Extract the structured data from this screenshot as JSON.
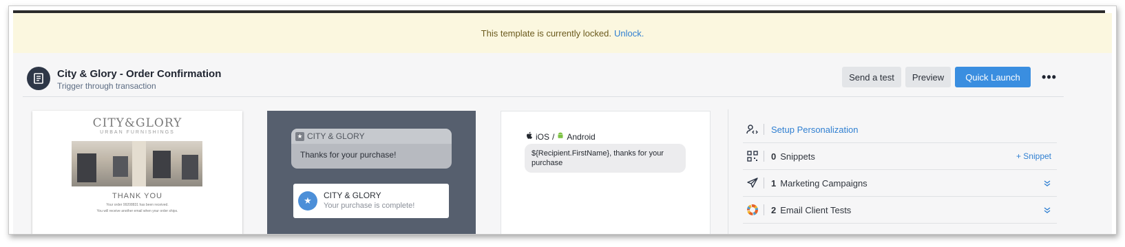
{
  "banner": {
    "text": "This template is currently locked.",
    "link": "Unlock."
  },
  "header": {
    "title": "City & Glory - Order Confirmation",
    "subtitle": "Trigger through transaction",
    "send_test": "Send a test",
    "preview": "Preview",
    "quick_launch": "Quick Launch",
    "more": "•••"
  },
  "email_preview": {
    "logo": "CITY&GLORY",
    "logo_sub": "URBAN FURNISHINGS",
    "thank_you": "THANK YOU",
    "line1": "Your order 99208831 has been received.",
    "line2": "You will receive another email when your order ships."
  },
  "push_preview": {
    "grey_app": "CITY & GLORY",
    "grey_body": "Thanks for your purchase!",
    "white_title": "CITY & GLORY",
    "white_body": "Your purchase is complete!"
  },
  "mobile_preview": {
    "platform_ios": "iOS",
    "platform_sep": "/",
    "platform_android": "Android",
    "message": "${Recipient.FirstName}, thanks for your purchase"
  },
  "side_panel": {
    "personalization": "Setup Personalization",
    "snippets_count": "0",
    "snippets_label": "Snippets",
    "add_snippet": "+ Snippet",
    "campaigns_count": "1",
    "campaigns_label": "Marketing Campaigns",
    "tests_count": "2",
    "tests_label": "Email Client Tests"
  },
  "colors": {
    "accent": "#3a8ee0",
    "banner_bg": "#fbf7df",
    "push_panel": "#565f6e",
    "link": "#2f7fd1"
  }
}
